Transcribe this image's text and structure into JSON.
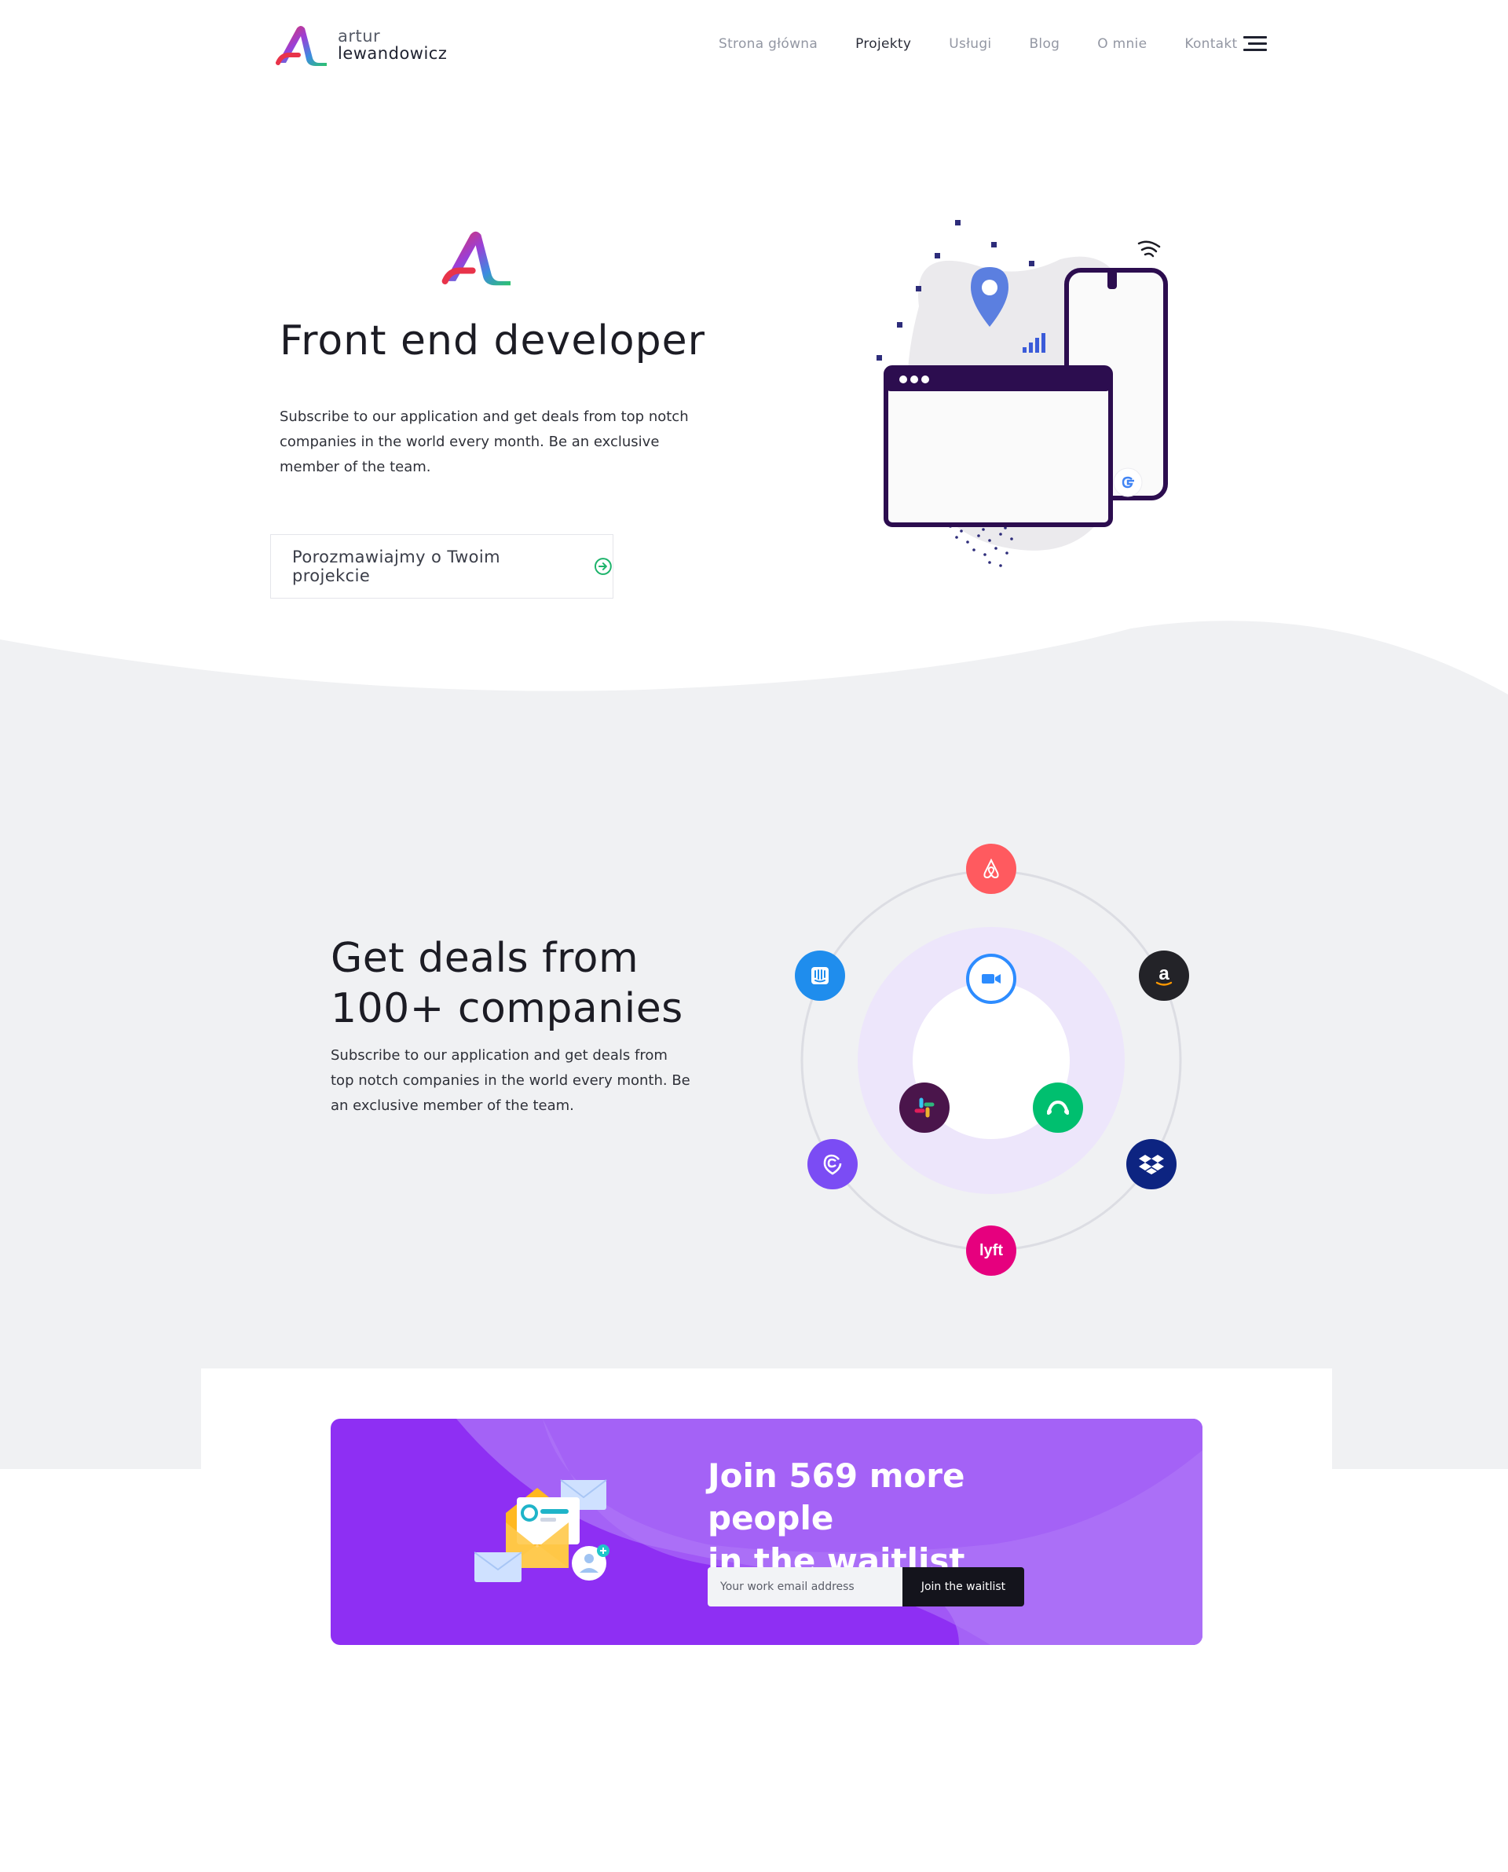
{
  "brand": {
    "first": "artur",
    "last": "lewandowicz"
  },
  "nav": {
    "items": [
      {
        "label": "Strona główna"
      },
      {
        "label": "Projekty"
      },
      {
        "label": "Usługi"
      },
      {
        "label": "Blog"
      },
      {
        "label": "O mnie"
      },
      {
        "label": "Kontakt"
      }
    ],
    "active": "Projekty"
  },
  "hero": {
    "title": "Front end developer",
    "text": "Subscribe to our application and get deals from top notch companies in the world every month. Be an exclusive member of the team.",
    "cta_label": "Porozmawiajmy o Twoim projekcie"
  },
  "deals": {
    "title_line1": "Get deals from",
    "title_line2": "100+ companies",
    "text": "Subscribe to our application and get deals from top notch companies in the world every month. Be an exclusive member of the team.",
    "logos": [
      "airbnb-icon",
      "amazon-icon",
      "dropbox-icon",
      "lyft-icon",
      "marker-logo-icon",
      "intercom-icon",
      "zoom-icon",
      "slack-icon",
      "surveymonkey-icon"
    ]
  },
  "waitlist": {
    "title_line1": "Join 569 more people",
    "title_line2": "in the waitlist",
    "email_placeholder": "Your work email address",
    "button_label": "Join the waitlist"
  },
  "colors": {
    "band": "#f0f1f3",
    "banner": "#8e2ff3",
    "banner_light": "#a462f6",
    "accent_green": "#1db36b",
    "dark_purple": "#2c0d4f"
  }
}
